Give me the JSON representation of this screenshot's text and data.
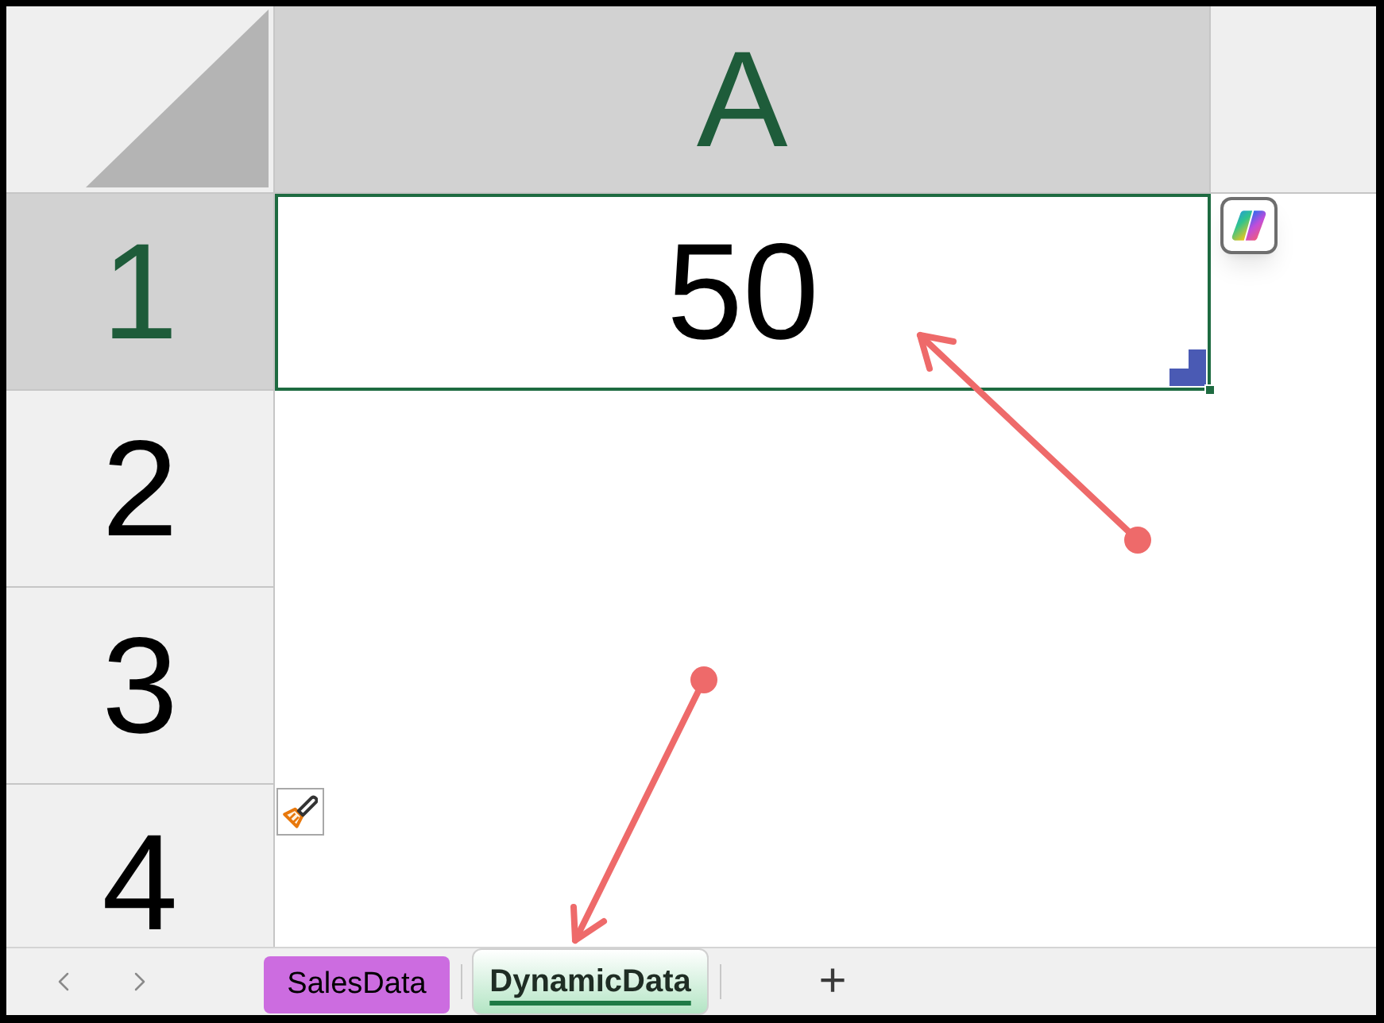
{
  "column_headers": [
    {
      "label": "A",
      "selected": true
    }
  ],
  "row_headers": [
    {
      "label": "1",
      "selected": true
    },
    {
      "label": "2",
      "selected": false
    },
    {
      "label": "3",
      "selected": false
    },
    {
      "label": "4",
      "selected": false
    }
  ],
  "active_cell": {
    "value": "50",
    "selected": true
  },
  "sheet_tabs": [
    {
      "label": "SalesData",
      "selected": false,
      "color": "#cc6ce0"
    },
    {
      "label": "DynamicData",
      "selected": true,
      "color": "#b3e5c4"
    }
  ],
  "new_sheet_button": {
    "label": "+"
  }
}
